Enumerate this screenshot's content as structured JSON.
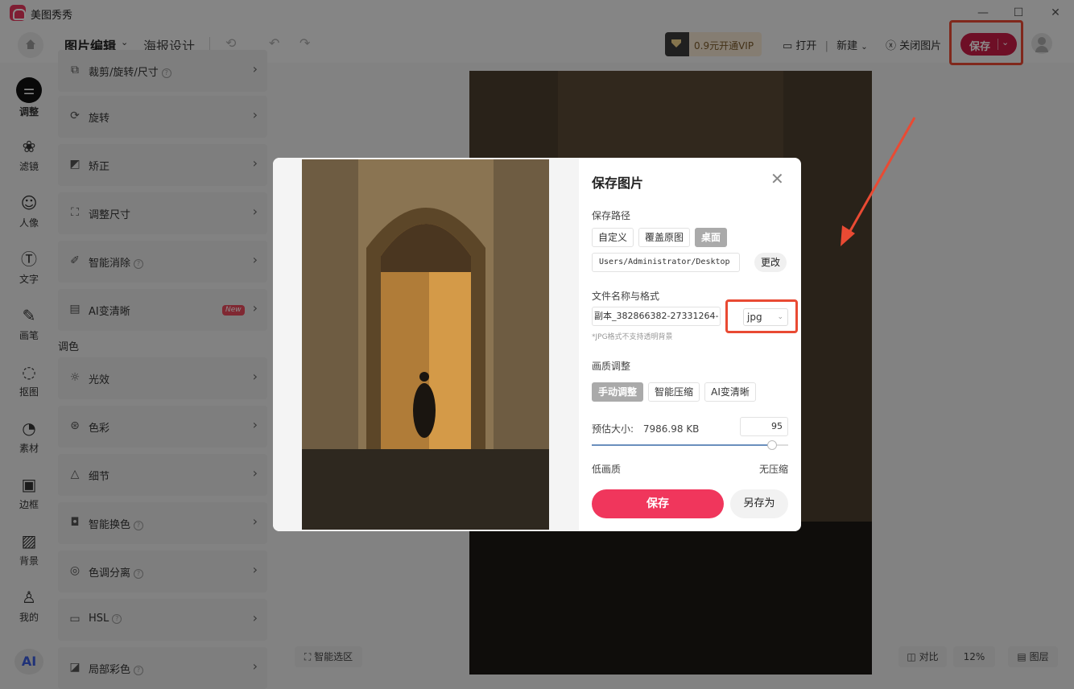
{
  "app": {
    "name": "美图秀秀"
  },
  "window": {
    "minimize": "—",
    "maximize": "☐",
    "close": "✕"
  },
  "toolbar": {
    "tab_edit": "图片编辑",
    "tab_poster": "海报设计",
    "vip": "0.9元开通VIP",
    "open": "打开",
    "new": "新建",
    "close_image": "关闭图片",
    "save": "保存"
  },
  "leftnav": {
    "items": [
      {
        "label": "调整",
        "icon": "sliders-icon"
      },
      {
        "label": "滤镜",
        "icon": "filter-icon"
      },
      {
        "label": "人像",
        "icon": "portrait-icon"
      },
      {
        "label": "文字",
        "icon": "text-icon"
      },
      {
        "label": "画笔",
        "icon": "brush-icon"
      },
      {
        "label": "抠图",
        "icon": "cutout-icon"
      },
      {
        "label": "素材",
        "icon": "sticker-icon"
      },
      {
        "label": "边框",
        "icon": "frame-icon"
      },
      {
        "label": "背景",
        "icon": "background-icon"
      },
      {
        "label": "我的",
        "icon": "user-icon"
      }
    ],
    "ai": "AI"
  },
  "panel": {
    "items": [
      {
        "label": "裁剪/旋转/尺寸",
        "help": true
      },
      {
        "label": "旋转",
        "help": false
      },
      {
        "label": "矫正",
        "help": false
      },
      {
        "label": "调整尺寸",
        "help": false
      },
      {
        "label": "智能消除",
        "help": true
      },
      {
        "label": "AI变清晰",
        "help": false,
        "badge": "New"
      }
    ],
    "section_color": "调色",
    "color_items": [
      {
        "label": "光效",
        "help": false
      },
      {
        "label": "色彩",
        "help": false
      },
      {
        "label": "细节",
        "help": false
      },
      {
        "label": "智能换色",
        "help": true
      },
      {
        "label": "色调分离",
        "help": true
      },
      {
        "label": "HSL",
        "help": true
      },
      {
        "label": "局部彩色",
        "help": true
      }
    ]
  },
  "canvas": {
    "smart_select": "智能选区",
    "compare": "对比",
    "zoom": "12%",
    "layers": "图层"
  },
  "dialog": {
    "title": "保存图片",
    "path_label": "保存路径",
    "path_options": [
      "自定义",
      "覆盖原图",
      "桌面"
    ],
    "path_selected": "桌面",
    "path_value": "Users/Administrator/Desktop",
    "change": "更改",
    "name_label": "文件名称与格式",
    "file_name": "-382866382-27331264_副本",
    "format": "jpg",
    "format_hint": "*JPG格式不支持透明背景",
    "quality_label": "画质调整",
    "quality_modes": [
      "手动调整",
      "智能压缩",
      "AI变清晰"
    ],
    "quality_mode_selected": "手动调整",
    "size_label": "预估大小:",
    "size_value": "7986.98 KB",
    "quality_value": "95",
    "quality_fraction": 0.92,
    "low": "低画质",
    "none": "无压缩",
    "save": "保存",
    "save_as": "另存为"
  },
  "colors": {
    "accent": "#f0365c",
    "save_top": "#c81c45",
    "annotation": "#e94a33"
  }
}
